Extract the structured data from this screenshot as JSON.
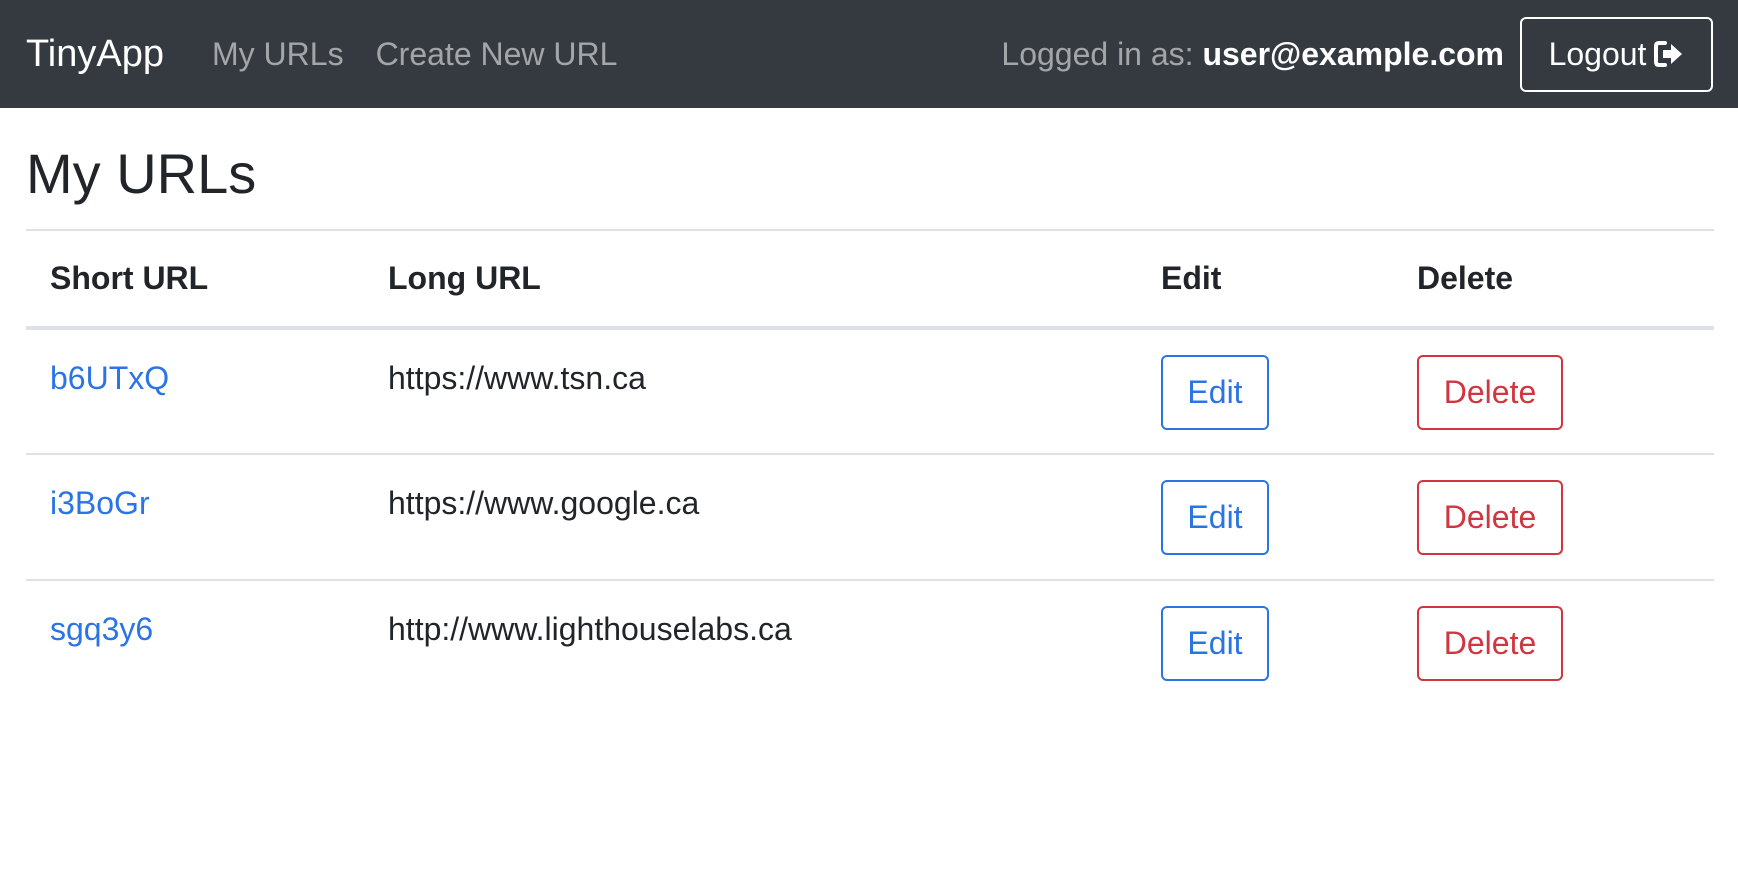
{
  "navbar": {
    "brand": "TinyApp",
    "links": [
      "My URLs",
      "Create New URL"
    ],
    "logged_in_label": "Logged in as:",
    "user_email": "user@example.com",
    "logout_label": "Logout",
    "logout_icon": "sign-out-icon"
  },
  "page": {
    "title": "My URLs"
  },
  "table": {
    "headers": [
      "Short URL",
      "Long URL",
      "Edit",
      "Delete"
    ],
    "rows": [
      {
        "short_url": "b6UTxQ",
        "long_url": "https://www.tsn.ca",
        "edit_label": "Edit",
        "delete_label": "Delete"
      },
      {
        "short_url": "i3BoGr",
        "long_url": "https://www.google.ca",
        "edit_label": "Edit",
        "delete_label": "Delete"
      },
      {
        "short_url": "sgq3y6",
        "long_url": "http://www.lighthouselabs.ca",
        "edit_label": "Edit",
        "delete_label": "Delete"
      }
    ]
  },
  "colors": {
    "navbar_bg": "#343a40",
    "link_primary": "#2a74e6",
    "danger": "#d1353f",
    "border": "#dee2e6"
  }
}
